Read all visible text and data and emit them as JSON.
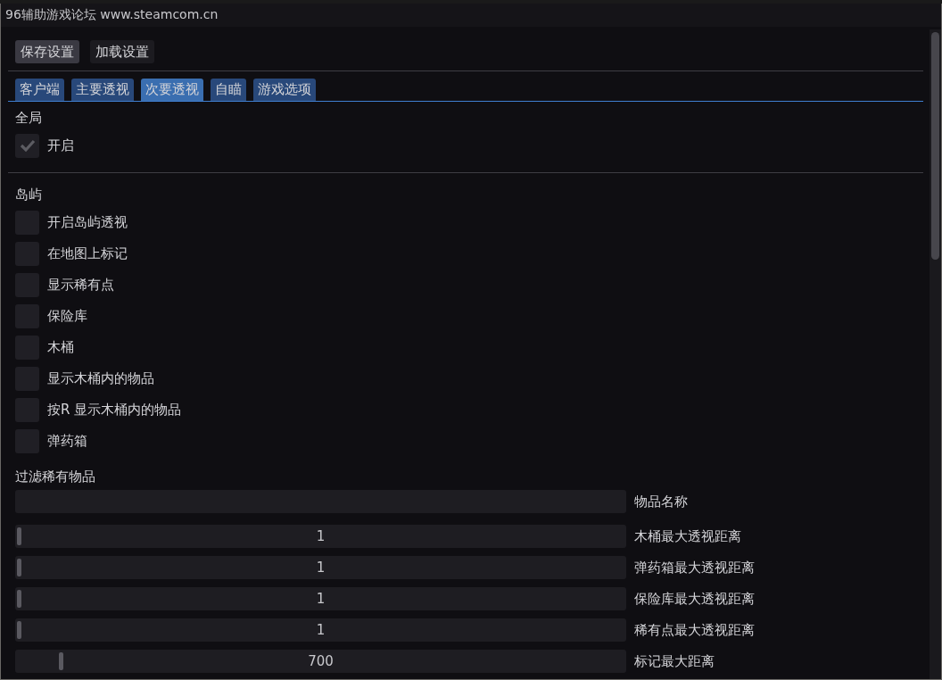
{
  "window": {
    "title": "96辅助游戏论坛 www.steamcom.cn"
  },
  "buttons": [
    {
      "label": "保存设置",
      "selected": true
    },
    {
      "label": "加载设置",
      "selected": false
    }
  ],
  "tabs": [
    {
      "label": "客户端",
      "selected": false
    },
    {
      "label": "主要透视",
      "selected": false
    },
    {
      "label": "次要透视",
      "selected": true
    },
    {
      "label": "自瞄",
      "selected": false
    },
    {
      "label": "游戏选项",
      "selected": false
    }
  ],
  "global": {
    "title": "全局",
    "checkboxes": [
      {
        "label": "开启",
        "checked": true
      }
    ]
  },
  "island": {
    "title": "岛屿",
    "checkboxes": [
      {
        "label": "开启岛屿透视",
        "checked": false
      },
      {
        "label": "在地图上标记",
        "checked": false
      },
      {
        "label": "显示稀有点",
        "checked": false
      },
      {
        "label": "保险库",
        "checked": false
      },
      {
        "label": "木桶",
        "checked": false
      },
      {
        "label": "显示木桶内的物品",
        "checked": false
      },
      {
        "label": "按R 显示木桶内的物品",
        "checked": false
      },
      {
        "label": "弹药箱",
        "checked": false
      }
    ]
  },
  "filter": {
    "title": "过滤稀有物品",
    "field_label": "物品名称"
  },
  "sliders": [
    {
      "label": "木桶最大透视距离",
      "reading": "1",
      "level": 0
    },
    {
      "label": "弹药箱最大透视距离",
      "reading": "1",
      "level": 0
    },
    {
      "label": "保险库最大透视距离",
      "reading": "1",
      "level": 0
    },
    {
      "label": "稀有点最大透视距离",
      "reading": "1",
      "level": 0
    },
    {
      "label": "标记最大距离",
      "reading": "700",
      "level": 0.07
    }
  ]
}
